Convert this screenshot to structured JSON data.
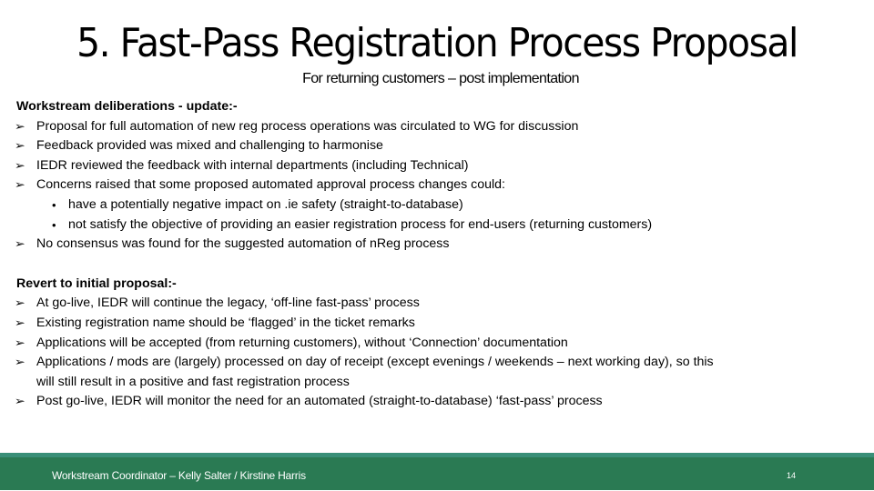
{
  "slide": {
    "title": "5. Fast-Pass Registration Process Proposal",
    "subtitle": "For returning customers – post implementation"
  },
  "section1": {
    "heading": "Workstream deliberations - update:-",
    "items": [
      "Proposal for full automation of new reg process operations was circulated to WG for discussion",
      "Feedback provided was mixed and challenging to harmonise",
      "IEDR reviewed the feedback with internal departments (including Technical)",
      "Concerns raised that some proposed automated approval process changes could:"
    ],
    "subitems": [
      "have a potentially negative impact on .ie safety (straight-to-database)",
      "not satisfy the objective of providing an easier registration process for end-users (returning customers)"
    ],
    "final_item": "No consensus was found for the suggested automation of nReg process"
  },
  "section2": {
    "heading": "Revert to initial proposal:-",
    "items": [
      "At go-live, IEDR will continue the legacy, ‘off-line fast-pass’ process",
      "Existing registration name should be ‘flagged’ in the ticket remarks",
      "Applications will be accepted (from returning customers), without ‘Connection’ documentation",
      "Applications / mods are (largely) processed on day of receipt (except evenings / weekends – next working day), so this"
    ],
    "item4_continuation": "will still result in a positive and fast registration process",
    "final_item": "Post go-live, IEDR will monitor the need for an automated (straight-to-database) ‘fast-pass’ process"
  },
  "glyphs": {
    "arrow_bullet": "➢",
    "dot_bullet": "•"
  },
  "footer": {
    "text": "Workstream Coordinator – Kelly Salter / Kirstine Harris",
    "page_number": "14",
    "colors": {
      "band": "#2a7a53",
      "strip": "#3a8f78"
    }
  }
}
